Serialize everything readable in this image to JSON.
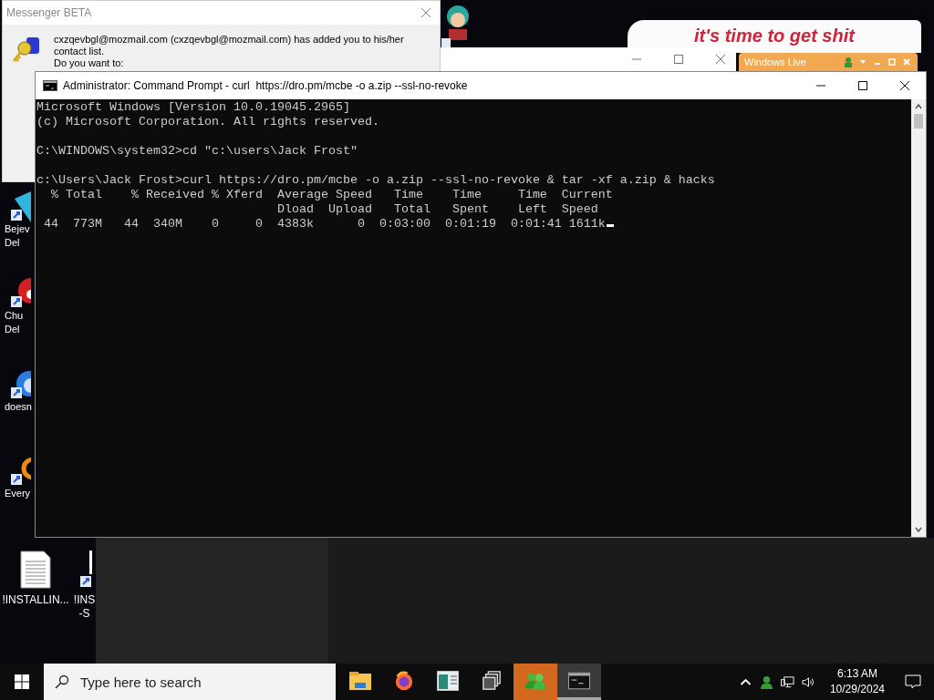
{
  "desktop_icons": [
    {
      "kind": "gem",
      "lines": [
        "Bejev",
        "Del"
      ]
    },
    {
      "kind": "flower",
      "lines": [
        "Chu",
        "Del"
      ]
    },
    {
      "kind": "bird",
      "lines": [
        "doesn"
      ]
    },
    {
      "kind": "ring",
      "lines": [
        "Every"
      ]
    }
  ],
  "desktop_files": [
    {
      "kind": "document",
      "lines": [
        "!INSTALLIN..."
      ]
    },
    {
      "kind": "shortcut",
      "lines": [
        "!INS",
        "-S"
      ]
    }
  ],
  "messenger_notification": {
    "title": "Messenger BETA",
    "message": "cxzqevbgl@mozmail.com (cxzqevbgl@mozmail.com) has added you to his/her contact list.",
    "prompt": "Do you want to:"
  },
  "banner": {
    "text": "it's time to get shit"
  },
  "windows_live": {
    "title": "Windows Live"
  },
  "command_prompt": {
    "title": "Administrator: Command Prompt - curl  https://dro.pm/mcbe -o a.zip --ssl-no-revoke",
    "cursor": true,
    "blocks": [
      [
        "Microsoft Windows [Version 10.0.19045.2965]",
        "(c) Microsoft Corporation. All rights reserved."
      ],
      [
        "C:\\WINDOWS\\system32>cd \"c:\\users\\Jack Frost\""
      ],
      [
        "c:\\Users\\Jack Frost>curl https://dro.pm/mcbe -o a.zip --ssl-no-revoke & tar -xf a.zip & hacks",
        "  % Total    % Received % Xferd  Average Speed   Time    Time     Time  Current",
        "                                 Dload  Upload   Total   Spent    Left  Speed",
        " 44  773M   44  340M    0     0  4383k      0  0:03:00  0:01:19  0:01:41 1611k"
      ]
    ]
  },
  "taskbar": {
    "search": {
      "placeholder": "Type here to search"
    },
    "apps": [
      {
        "kind": "folder",
        "active": false,
        "flashing": false
      },
      {
        "kind": "browser",
        "active": false,
        "flashing": false
      },
      {
        "kind": "app",
        "active": false,
        "flashing": false
      },
      {
        "kind": "taskview",
        "active": false,
        "flashing": false
      },
      {
        "kind": "messenger",
        "active": false,
        "flashing": true
      },
      {
        "kind": "terminal",
        "active": true,
        "flashing": false
      }
    ],
    "clock": {
      "time": "6:13 AM",
      "date": "10/29/2024"
    }
  }
}
